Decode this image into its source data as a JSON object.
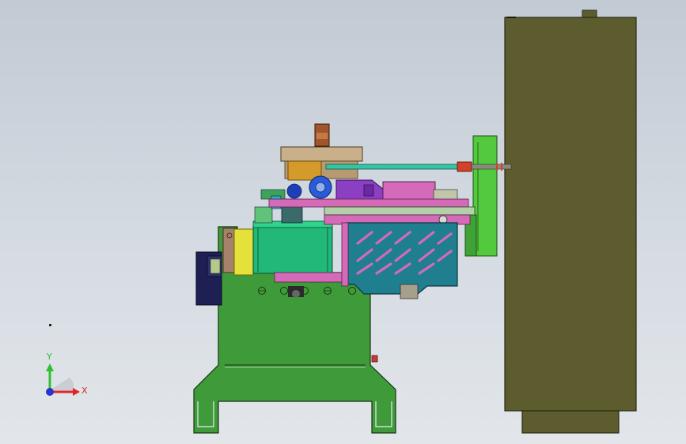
{
  "viewport": {
    "background_top": "#c2cad4",
    "background_bottom": "#e2e6ea"
  },
  "model": {
    "colors": {
      "base": "#3f9a3a",
      "cabinet": "#5c5c2f",
      "motor_drum": "#21b87a",
      "yellow_block": "#e6e13a",
      "navy_motor": "#1e1f52",
      "teal_cover": "#1f7f8f",
      "top_plate": "#c9b08a",
      "pink_rails": "#d46ab8",
      "purple_head": "#8b3fc2",
      "arm_bar": "#34c4a6",
      "green_bracket": "#53c93d"
    }
  },
  "triad": {
    "x_label": "X",
    "y_label": "Y",
    "x_color": "#e0262b",
    "y_color": "#2fbf2f",
    "z_color": "#2a34c9"
  }
}
